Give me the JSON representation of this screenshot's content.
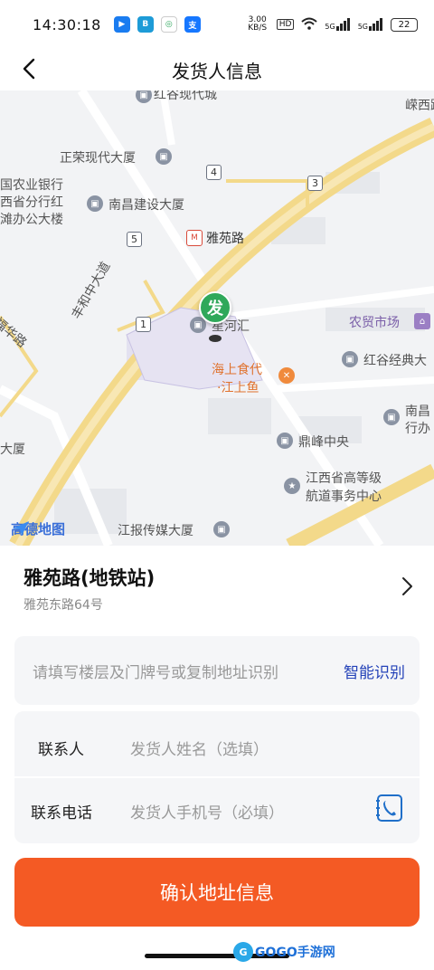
{
  "status_bar": {
    "time": "14:30:18",
    "net_speed": "3.00 KB/S",
    "hd_badge": "HD",
    "signal_1": "5G",
    "signal_2": "5G",
    "battery": "22"
  },
  "header": {
    "title": "发货人信息"
  },
  "map": {
    "provider_logo": "高德地图",
    "pin_label": "发",
    "labels": {
      "hongu_modern_city": "红谷现代城",
      "zhengrong": "正荣现代大厦",
      "agri_bank": "国农业银行\n西省分行红\n滩办公大楼",
      "nanchang_construction": "南昌建设大厦",
      "yayuan_road": "雅苑路",
      "fengheizhong": "丰和中大道",
      "fuhua": "福华路",
      "xinghe": "星河汇",
      "haishang_1": "海上食代",
      "haishang_2": "·江上鱼",
      "nongmao": "农贸市场",
      "honggu_jingdian": "红谷经典大",
      "nanchang_xing": "南昌",
      "nanchang_xing2": "行办",
      "dingfeng": "鼎峰中央",
      "jiangxi_school_1": "江西省高等级",
      "jiangxi_school_2": "航道事务中心",
      "jiangbao": "江报传媒大厦",
      "dasha_left": "大厦",
      "top_right_road": "嵘西路"
    },
    "exit_badges": [
      "4",
      "3",
      "5",
      "1"
    ]
  },
  "location": {
    "name": "雅苑路(地铁站)",
    "address": "雅苑东路64号"
  },
  "address_card": {
    "placeholder": "请填写楼层及门牌号或复制地址识别",
    "smart_recognize": "智能识别"
  },
  "contact_card": {
    "name_label": "联系人",
    "name_placeholder": "发货人姓名（选填）",
    "phone_label": "联系电话",
    "phone_placeholder": "发货人手机号（必填）"
  },
  "confirm_button": "确认地址信息",
  "watermark": "GOGO手游网",
  "colors": {
    "accent": "#f45a24",
    "link": "#2442b8",
    "pin": "#2fa85a",
    "road": "#f3d98a",
    "map_bg": "#f2f3f5"
  }
}
